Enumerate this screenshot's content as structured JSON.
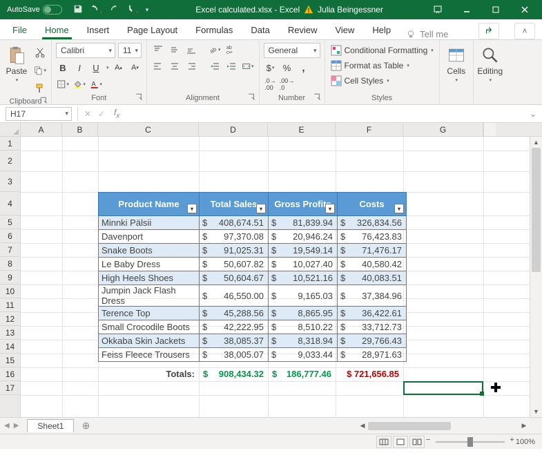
{
  "titlebar": {
    "autosave_label": "AutoSave",
    "autosave_state": "Off",
    "filename": "Excel calculated.xlsx - Excel",
    "user": "Julia Beingessner"
  },
  "ribbon_tabs": [
    "File",
    "Home",
    "Insert",
    "Page Layout",
    "Formulas",
    "Data",
    "Review",
    "View",
    "Help"
  ],
  "active_tab": "Home",
  "tell_me": "Tell me",
  "ribbon": {
    "clipboard": {
      "label": "Clipboard",
      "paste": "Paste"
    },
    "font": {
      "label": "Font",
      "name": "Calibri",
      "size": "11",
      "bold": "B",
      "italic": "I",
      "underline": "U"
    },
    "alignment": {
      "label": "Alignment"
    },
    "number": {
      "label": "Number",
      "format": "General"
    },
    "styles": {
      "label": "Styles",
      "cond_fmt": "Conditional Formatting",
      "tbl_fmt": "Format as Table",
      "cell_styles": "Cell Styles"
    },
    "cells": {
      "label": "Cells"
    },
    "editing": {
      "label": "Editing"
    }
  },
  "namebox": "H17",
  "columns": [
    "A",
    "B",
    "C",
    "D",
    "E",
    "F",
    "G"
  ],
  "rows": [
    "1",
    "2",
    "3",
    "4",
    "5",
    "6",
    "7",
    "8",
    "9",
    "10",
    "11",
    "12",
    "13",
    "14",
    "15",
    "16",
    "17"
  ],
  "table": {
    "headers": [
      "Product Name",
      "Total Sales",
      "Gross Profits",
      "Costs"
    ],
    "rows": [
      {
        "name": "Minnki Pälsii",
        "sales": "408,674.51",
        "profits": "81,839.94",
        "costs": "326,834.56"
      },
      {
        "name": "Davenport",
        "sales": "97,370.08",
        "profits": "20,946.24",
        "costs": "76,423.83"
      },
      {
        "name": "Snake Boots",
        "sales": "91,025.31",
        "profits": "19,549.14",
        "costs": "71,476.17"
      },
      {
        "name": "Le Baby Dress",
        "sales": "50,607.82",
        "profits": "10,027.40",
        "costs": "40,580.42"
      },
      {
        "name": "High Heels Shoes",
        "sales": "50,604.67",
        "profits": "10,521.16",
        "costs": "40,083.51"
      },
      {
        "name": "Jumpin Jack Flash Dress",
        "sales": "46,550.00",
        "profits": "9,165.03",
        "costs": "37,384.96"
      },
      {
        "name": "Terence Top",
        "sales": "45,288.56",
        "profits": "8,865.95",
        "costs": "36,422.61"
      },
      {
        "name": "Small Crocodile Boots",
        "sales": "42,222.95",
        "profits": "8,510.22",
        "costs": "33,712.73"
      },
      {
        "name": "Okkaba Skin Jackets",
        "sales": "38,085.37",
        "profits": "8,318.94",
        "costs": "29,766.43"
      },
      {
        "name": "Feiss Fleece Trousers",
        "sales": "38,005.07",
        "profits": "9,033.44",
        "costs": "28,971.63"
      }
    ],
    "currency": "$",
    "totals_label": "Totals:",
    "totals": {
      "sales": "908,434.32",
      "profits": "186,777.46",
      "costs": "$ 721,656.85"
    }
  },
  "sheet": {
    "name": "Sheet1"
  },
  "statusbar": {
    "zoom": "100%"
  }
}
